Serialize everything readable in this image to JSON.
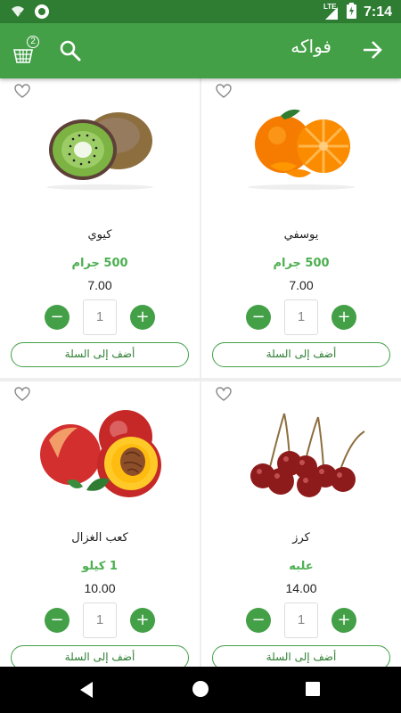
{
  "status_bar": {
    "time": "7:14",
    "network": "LTE",
    "icons": [
      "wifi-question-icon",
      "circle-notification-icon",
      "signal-icon",
      "battery-charging-icon"
    ]
  },
  "app_bar": {
    "title": "فواكه",
    "cart_count": "2",
    "icons": [
      "basket-icon",
      "search-icon",
      "arrow-forward-icon"
    ]
  },
  "colors": {
    "status_bar": "#2e7d32",
    "app_bar": "#43a047",
    "accent": "#4caf50"
  },
  "products": [
    {
      "name": "يوسفي",
      "weight": "500 جرام",
      "price": "7.00",
      "quantity": "1",
      "add_label": "أضف إلى السلة",
      "image": "tangerine-image"
    },
    {
      "name": "كيوي",
      "weight": "500 جرام",
      "price": "7.00",
      "quantity": "1",
      "add_label": "أضف إلى السلة",
      "image": "kiwi-image"
    },
    {
      "name": "كرز",
      "weight": "علبه",
      "price": "14.00",
      "quantity": "1",
      "add_label": "أضف إلى السلة",
      "image": "cherries-image"
    },
    {
      "name": "كعب الغزال",
      "weight": "1 كيلو",
      "price": "10.00",
      "quantity": "1",
      "add_label": "أضف إلى السلة",
      "image": "nectarine-image"
    }
  ],
  "nav_bar": {
    "icons": [
      "nav-back-icon",
      "nav-home-icon",
      "nav-recents-icon"
    ]
  }
}
